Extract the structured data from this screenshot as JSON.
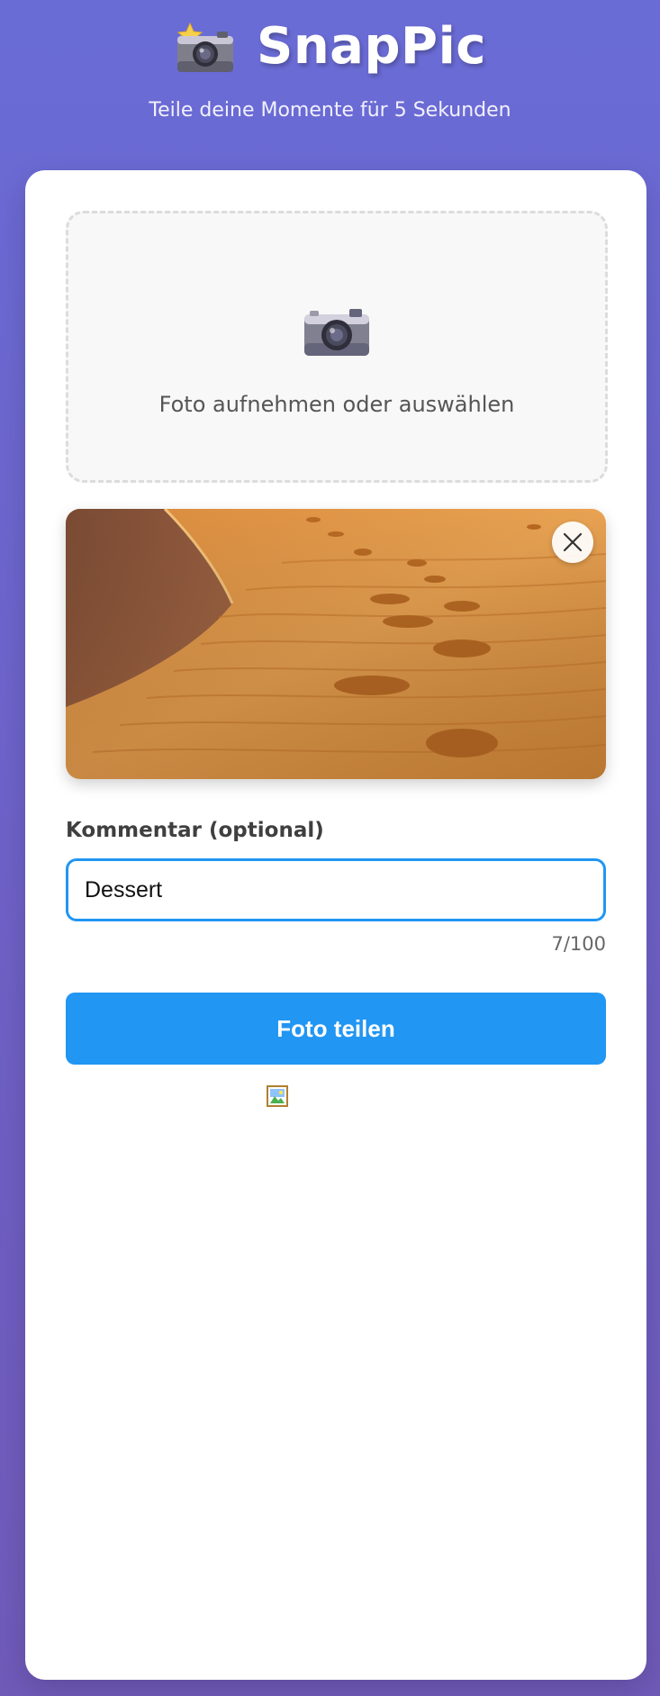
{
  "header": {
    "app_name": "SnapPic",
    "subtitle": "Teile deine Momente für 5 Sekunden",
    "logo_icon": "camera-with-flash-icon"
  },
  "upload": {
    "prompt": "Foto aufnehmen oder auswählen",
    "icon": "camera-icon"
  },
  "preview": {
    "remove_icon": "close-icon",
    "image": "desert-dune-footprints-photo"
  },
  "comment": {
    "label": "Kommentar (optional)",
    "value": "Dessert",
    "char_count": "7/100"
  },
  "actions": {
    "share_label": "Foto teilen"
  },
  "status": {
    "icon": "broken-image-icon"
  },
  "colors": {
    "background_gradient_top": "#6a6cd6",
    "background_gradient_bottom": "#6f5ab8",
    "accent": "#2196f3",
    "card": "#ffffff"
  }
}
